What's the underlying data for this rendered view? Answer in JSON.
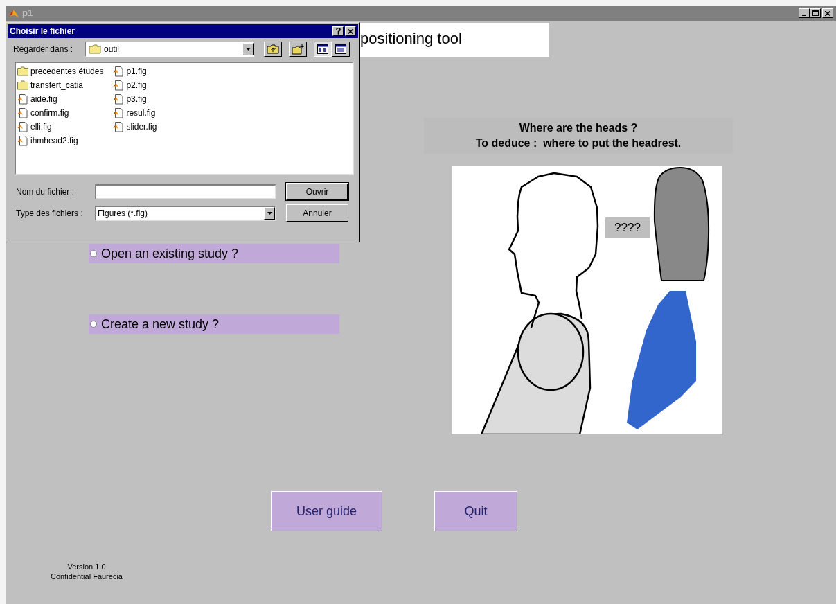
{
  "window": {
    "title": "p1"
  },
  "app": {
    "title": "positioning tool",
    "options": [
      {
        "label": "Open an existing study ?",
        "selected": false
      },
      {
        "label": "Create a new study ?",
        "selected": false
      }
    ],
    "question": [
      "Where are the heads ?",
      "To deduce :  where to put the headrest."
    ],
    "figure_label": "????",
    "buttons": [
      "User guide",
      "Quit"
    ],
    "footer": [
      "Version 1.0",
      "Confidential Faurecia"
    ]
  },
  "dialog": {
    "title": "Choisir le fichier",
    "look_in_label": "Regarder dans :",
    "look_in_value": "outil",
    "views": [
      {
        "kind": "list",
        "selected": true
      },
      {
        "kind": "details",
        "selected": false
      }
    ],
    "files": [
      {
        "name": "precedentes études",
        "kind": "folder"
      },
      {
        "name": "transfert_catia",
        "kind": "folder"
      },
      {
        "name": "aide.fig",
        "kind": "figure"
      },
      {
        "name": "confirm.fig",
        "kind": "figure"
      },
      {
        "name": "elli.fig",
        "kind": "figure"
      },
      {
        "name": "ihmhead2.fig",
        "kind": "figure"
      },
      {
        "name": "p1.fig",
        "kind": "figure"
      },
      {
        "name": "p2.fig",
        "kind": "figure"
      },
      {
        "name": "p3.fig",
        "kind": "figure"
      },
      {
        "name": "resul.fig",
        "kind": "figure"
      },
      {
        "name": "slider.fig",
        "kind": "figure"
      }
    ],
    "file_name_label": "Nom du fichier :",
    "file_type_label": "Type des fichiers :",
    "file_type_value": "Figures (*.fig)",
    "buttons": [
      "Ouvrir",
      "Annuler"
    ]
  }
}
